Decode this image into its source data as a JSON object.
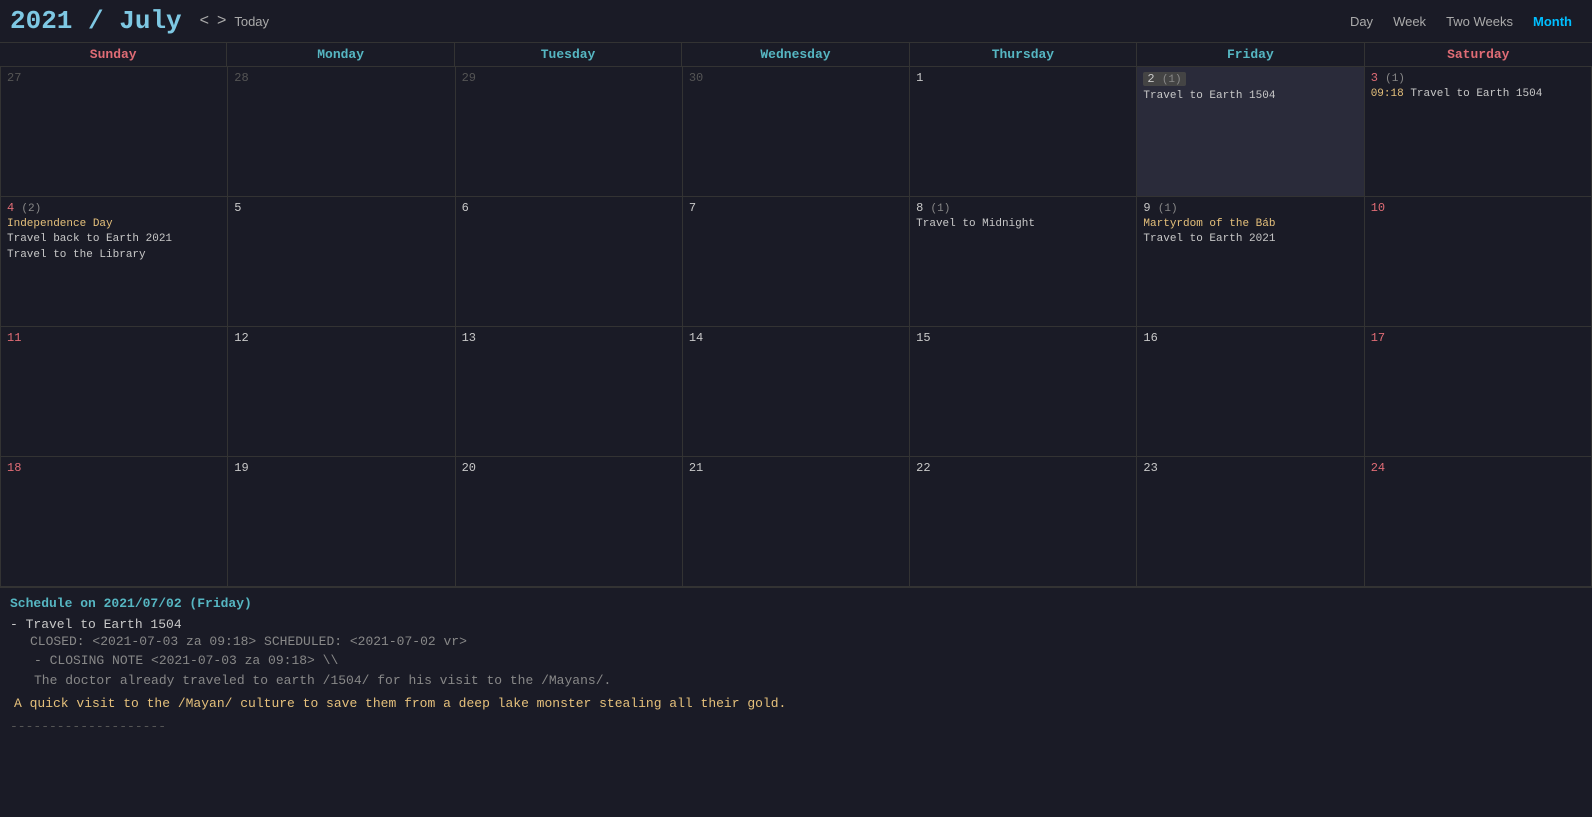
{
  "header": {
    "year": "2021",
    "slash": " / ",
    "month": "July",
    "prev_label": "<",
    "next_label": ">",
    "today_label": "Today",
    "views": [
      "Day",
      "Week",
      "Two Weeks",
      "Month"
    ],
    "active_view": "Month"
  },
  "day_headers": [
    {
      "label": "Sunday",
      "class": "sun"
    },
    {
      "label": "Monday",
      "class": "weekday"
    },
    {
      "label": "Tuesday",
      "class": "weekday"
    },
    {
      "label": "Wednesday",
      "class": "weekday"
    },
    {
      "label": "Thursday",
      "class": "weekday"
    },
    {
      "label": "Friday",
      "class": "weekday"
    },
    {
      "label": "Saturday",
      "class": "sat"
    }
  ],
  "weeks": [
    [
      {
        "num": "27",
        "badi": "",
        "sun": false,
        "sat": false,
        "other": true,
        "events": []
      },
      {
        "num": "28",
        "badi": "",
        "sun": false,
        "sat": false,
        "other": true,
        "events": []
      },
      {
        "num": "29",
        "badi": "",
        "sun": false,
        "sat": false,
        "other": true,
        "events": []
      },
      {
        "num": "30",
        "badi": "",
        "sun": false,
        "sat": false,
        "other": true,
        "events": []
      },
      {
        "num": "1",
        "badi": "",
        "sun": false,
        "sat": false,
        "other": false,
        "events": []
      },
      {
        "num": "2",
        "badi": "(1)",
        "sun": false,
        "sat": false,
        "other": false,
        "highlight": true,
        "events": [
          {
            "text": "Travel to Earth 1504",
            "holiday": false,
            "time": ""
          }
        ]
      },
      {
        "num": "3",
        "badi": "(1)",
        "sun": false,
        "sat": true,
        "other": false,
        "events": [
          {
            "text": "Travel to Earth 1504",
            "holiday": false,
            "time": "09:18 "
          }
        ]
      }
    ],
    [
      {
        "num": "4",
        "badi": "(2)",
        "sun": true,
        "sat": false,
        "other": false,
        "events": [
          {
            "text": "Independence Day",
            "holiday": true,
            "time": ""
          },
          {
            "text": "Travel back to Earth 2021",
            "holiday": false,
            "time": ""
          },
          {
            "text": "Travel to the Library",
            "holiday": false,
            "time": ""
          }
        ]
      },
      {
        "num": "5",
        "badi": "",
        "sun": false,
        "sat": false,
        "other": false,
        "events": []
      },
      {
        "num": "6",
        "badi": "",
        "sun": false,
        "sat": false,
        "other": false,
        "events": []
      },
      {
        "num": "7",
        "badi": "",
        "sun": false,
        "sat": false,
        "other": false,
        "events": []
      },
      {
        "num": "8",
        "badi": "(1)",
        "sun": false,
        "sat": false,
        "other": false,
        "events": [
          {
            "text": "Travel to Midnight",
            "holiday": false,
            "time": ""
          }
        ]
      },
      {
        "num": "9",
        "badi": "(1)",
        "sun": false,
        "sat": false,
        "other": false,
        "events": [
          {
            "text": "Martyrdom of the Báb",
            "holiday": true,
            "time": ""
          },
          {
            "text": "Travel to Earth 2021",
            "holiday": false,
            "time": ""
          }
        ]
      },
      {
        "num": "10",
        "badi": "",
        "sun": false,
        "sat": true,
        "other": false,
        "events": []
      }
    ],
    [
      {
        "num": "11",
        "badi": "",
        "sun": true,
        "sat": false,
        "other": false,
        "events": []
      },
      {
        "num": "12",
        "badi": "",
        "sun": false,
        "sat": false,
        "other": false,
        "events": []
      },
      {
        "num": "13",
        "badi": "",
        "sun": false,
        "sat": false,
        "other": false,
        "events": []
      },
      {
        "num": "14",
        "badi": "",
        "sun": false,
        "sat": false,
        "other": false,
        "events": []
      },
      {
        "num": "15",
        "badi": "",
        "sun": false,
        "sat": false,
        "other": false,
        "events": []
      },
      {
        "num": "16",
        "badi": "",
        "sun": false,
        "sat": false,
        "other": false,
        "events": []
      },
      {
        "num": "17",
        "badi": "",
        "sun": false,
        "sat": true,
        "other": false,
        "events": []
      }
    ],
    [
      {
        "num": "18",
        "badi": "",
        "sun": true,
        "sat": false,
        "other": false,
        "events": []
      },
      {
        "num": "19",
        "badi": "",
        "sun": false,
        "sat": false,
        "other": false,
        "events": []
      },
      {
        "num": "20",
        "badi": "",
        "sun": false,
        "sat": false,
        "other": false,
        "events": []
      },
      {
        "num": "21",
        "badi": "",
        "sun": false,
        "sat": false,
        "other": false,
        "events": []
      },
      {
        "num": "22",
        "badi": "",
        "sun": false,
        "sat": false,
        "other": false,
        "events": []
      },
      {
        "num": "23",
        "badi": "",
        "sun": false,
        "sat": false,
        "other": false,
        "events": []
      },
      {
        "num": "24",
        "badi": "",
        "sun": false,
        "sat": true,
        "other": false,
        "events": []
      }
    ]
  ],
  "schedule": {
    "title": "Schedule on 2021/07/02 (Friday)",
    "items": [
      {
        "title": "- Travel to Earth 1504",
        "meta1": "CLOSED: <2021-07-03 za 09:18> SCHEDULED: <2021-07-02 vr>",
        "note_label": "- CLOSING NOTE <2021-07-03 za 09:18> \\\\",
        "note_line1": "  The doctor already traveled to earth /1504/ for his visit to the /Mayans/.",
        "desc": "A quick visit to the /Mayan/ culture to save them from a deep lake monster stealing all their gold."
      }
    ],
    "divider": "--------------------"
  }
}
